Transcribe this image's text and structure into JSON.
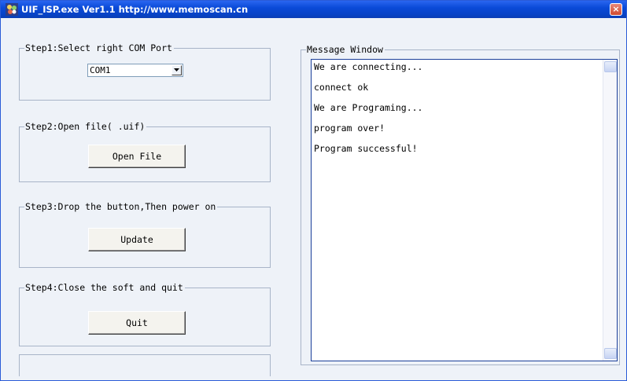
{
  "window": {
    "title": "UIF_ISP.exe  Ver1.1  http://www.memoscan.cn",
    "close_glyph": "×"
  },
  "steps": {
    "step1": {
      "label": "Step1:Select right COM Port",
      "com_port_value": "COM1"
    },
    "step2": {
      "label": "Step2:Open file( .uif)",
      "button": "Open File"
    },
    "step3": {
      "label": "Step3:Drop the button,Then power on",
      "button": "Update"
    },
    "step4": {
      "label": "Step4:Close the soft and quit",
      "button": "Quit"
    }
  },
  "message_window": {
    "label": "Message Window",
    "lines": [
      "We are connecting...",
      "connect ok",
      "We are Programing...",
      "program over!",
      "Program successful!"
    ]
  },
  "icons": {
    "app": "app-icon",
    "close": "close-icon",
    "dropdown": "chevron-down-icon"
  },
  "colors": {
    "titlebar": "#0a4ad8",
    "window_bg": "#eef2f8",
    "close_button": "#cf4a2f"
  }
}
